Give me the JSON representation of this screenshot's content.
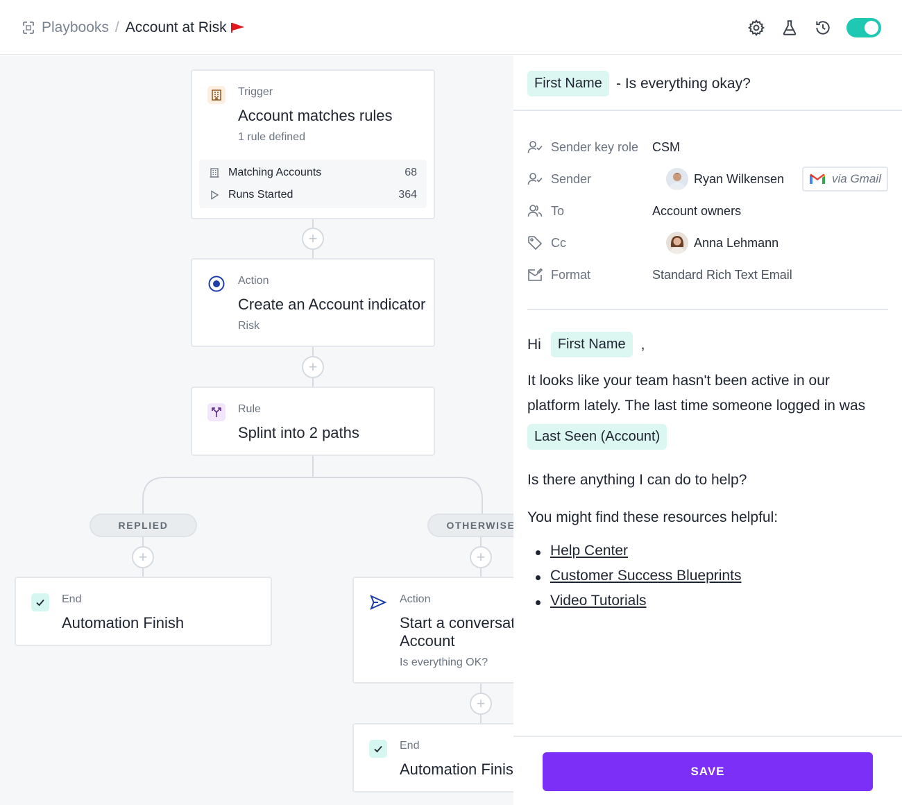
{
  "header": {
    "breadcrumb_root": "Playbooks",
    "breadcrumb_sep": "/",
    "breadcrumb_current": "Account at Risk",
    "toggle_on": true,
    "accent": "#1ec8b3"
  },
  "canvas": {
    "trigger": {
      "kind": "Trigger",
      "title": "Account matches rules",
      "sub": "1 rule defined",
      "stats": [
        {
          "label": "Matching Accounts",
          "value": "68"
        },
        {
          "label": "Runs Started",
          "value": "364"
        }
      ]
    },
    "action1": {
      "kind": "Action",
      "title": "Create an Account indicator",
      "sub": "Risk"
    },
    "rule": {
      "kind": "Rule",
      "title": "Splint into 2 paths"
    },
    "branches": {
      "left": "REPLIED",
      "right": "OTHERWISE"
    },
    "end_left": {
      "kind": "End",
      "title": "Automation Finish"
    },
    "action2": {
      "kind": "Action",
      "title": "Start a conversati",
      "title2": "Account",
      "sub": "Is everything OK?"
    },
    "end_right": {
      "kind": "End",
      "title": "Automation Finis"
    }
  },
  "panel": {
    "subject_chip": "First Name",
    "subject_text": "- Is everything okay?",
    "fields": {
      "sender_key_role": {
        "label": "Sender key role",
        "value": "CSM"
      },
      "sender": {
        "label": "Sender",
        "value": "Ryan Wilkensen",
        "via": "via Gmail"
      },
      "to": {
        "label": "To",
        "value": "Account owners"
      },
      "cc": {
        "label": "Cc",
        "value": "Anna Lehmann"
      },
      "format": {
        "label": "Format",
        "value": "Standard Rich Text Email"
      }
    },
    "body": {
      "greeting": "Hi",
      "greeting_chip": "First Name",
      "greeting_comma": ",",
      "para1_line1": "It looks like your team hasn't been active in our",
      "para1_line2": "platform lately. The last time someone logged in was",
      "para1_chip": "Last Seen (Account)",
      "para2": "Is there anything I can do to help?",
      "para3": "You might find these resources helpful:",
      "links": [
        "Help Center",
        "Customer Success Blueprints",
        "Video Tutorials"
      ]
    },
    "save_label": "SAVE",
    "save_color": "#7b2ff7"
  }
}
